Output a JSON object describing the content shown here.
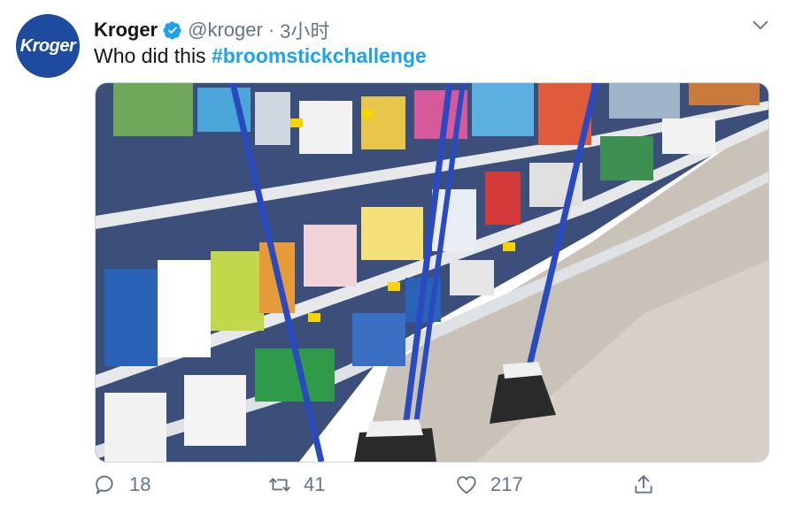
{
  "author": {
    "name": "Kroger",
    "handle": "@kroger",
    "separator": "·",
    "timestamp": "3小时",
    "avatar_text": "Kroger",
    "verified_icon": "verified-badge-icon",
    "brand_color": "#1f4b9e"
  },
  "menu": {
    "icon": "chevron-down-icon"
  },
  "tweet": {
    "text": "Who did this",
    "hashtag": "#broomstickchallenge",
    "hashtag_color": "#1da1f2"
  },
  "media": {
    "image_icon": "photo",
    "scene_colors": {
      "floor": "#c9c2b8",
      "shelf": "#d9dde0",
      "broom_handle": "#2a4bbf",
      "broom_head": "#2a2a2a"
    }
  },
  "actions": {
    "reply": {
      "icon": "reply-icon",
      "count": "18"
    },
    "retweet": {
      "icon": "retweet-icon",
      "count": "41"
    },
    "like": {
      "icon": "heart-icon",
      "count": "217"
    },
    "share": {
      "icon": "share-icon"
    }
  }
}
